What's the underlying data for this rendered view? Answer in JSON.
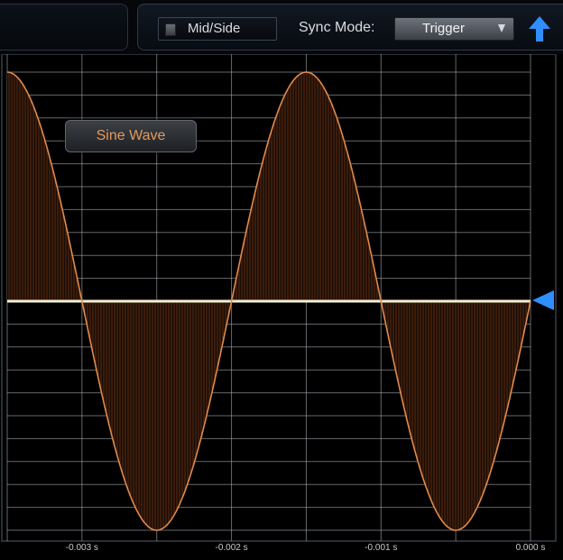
{
  "toolbar": {
    "midside_label": "Mid/Side",
    "sync_label": "Sync Mode:",
    "sync_value": "Trigger",
    "icons": {
      "midside_toggle": "checkbox-led-icon",
      "dropdown": "chevron-down-icon",
      "collapse": "arrow-up-icon"
    },
    "accent_color": "#2f8fff"
  },
  "scope": {
    "badge_label": "Sine Wave",
    "wave_color": "#e08a4c",
    "baseline_color": "#f4f0d2",
    "grid_color": "#b8bcc2",
    "level_marker_icon": "triangle-left-icon"
  },
  "chart_data": {
    "type": "line",
    "title": "Sine Wave",
    "xlabel": "",
    "ylabel": "",
    "xlim": [
      -0.0035,
      0.0
    ],
    "ylim": [
      -1.0,
      1.0
    ],
    "grid": true,
    "fill_to_zero": true,
    "x_ticks": [
      -0.003,
      -0.002,
      -0.001,
      0.0
    ],
    "x_tick_labels": [
      "-0.003 s",
      "-0.002 s",
      "-0.001 s",
      "0.000 s"
    ],
    "series": [
      {
        "function": "sine",
        "amplitude": 1.0,
        "period_s": 0.002,
        "x": [
          -0.0035,
          -0.00325,
          -0.003,
          -0.00275,
          -0.0025,
          -0.00225,
          -0.002,
          -0.00175,
          -0.0015,
          -0.00125,
          -0.001,
          -0.00075,
          -0.0005,
          -0.00025,
          0.0
        ],
        "y": [
          1.0,
          0.707,
          0.0,
          -0.707,
          -1.0,
          -0.707,
          0.0,
          0.707,
          1.0,
          0.707,
          0.0,
          -0.707,
          -1.0,
          -0.707,
          0.0
        ]
      }
    ]
  }
}
